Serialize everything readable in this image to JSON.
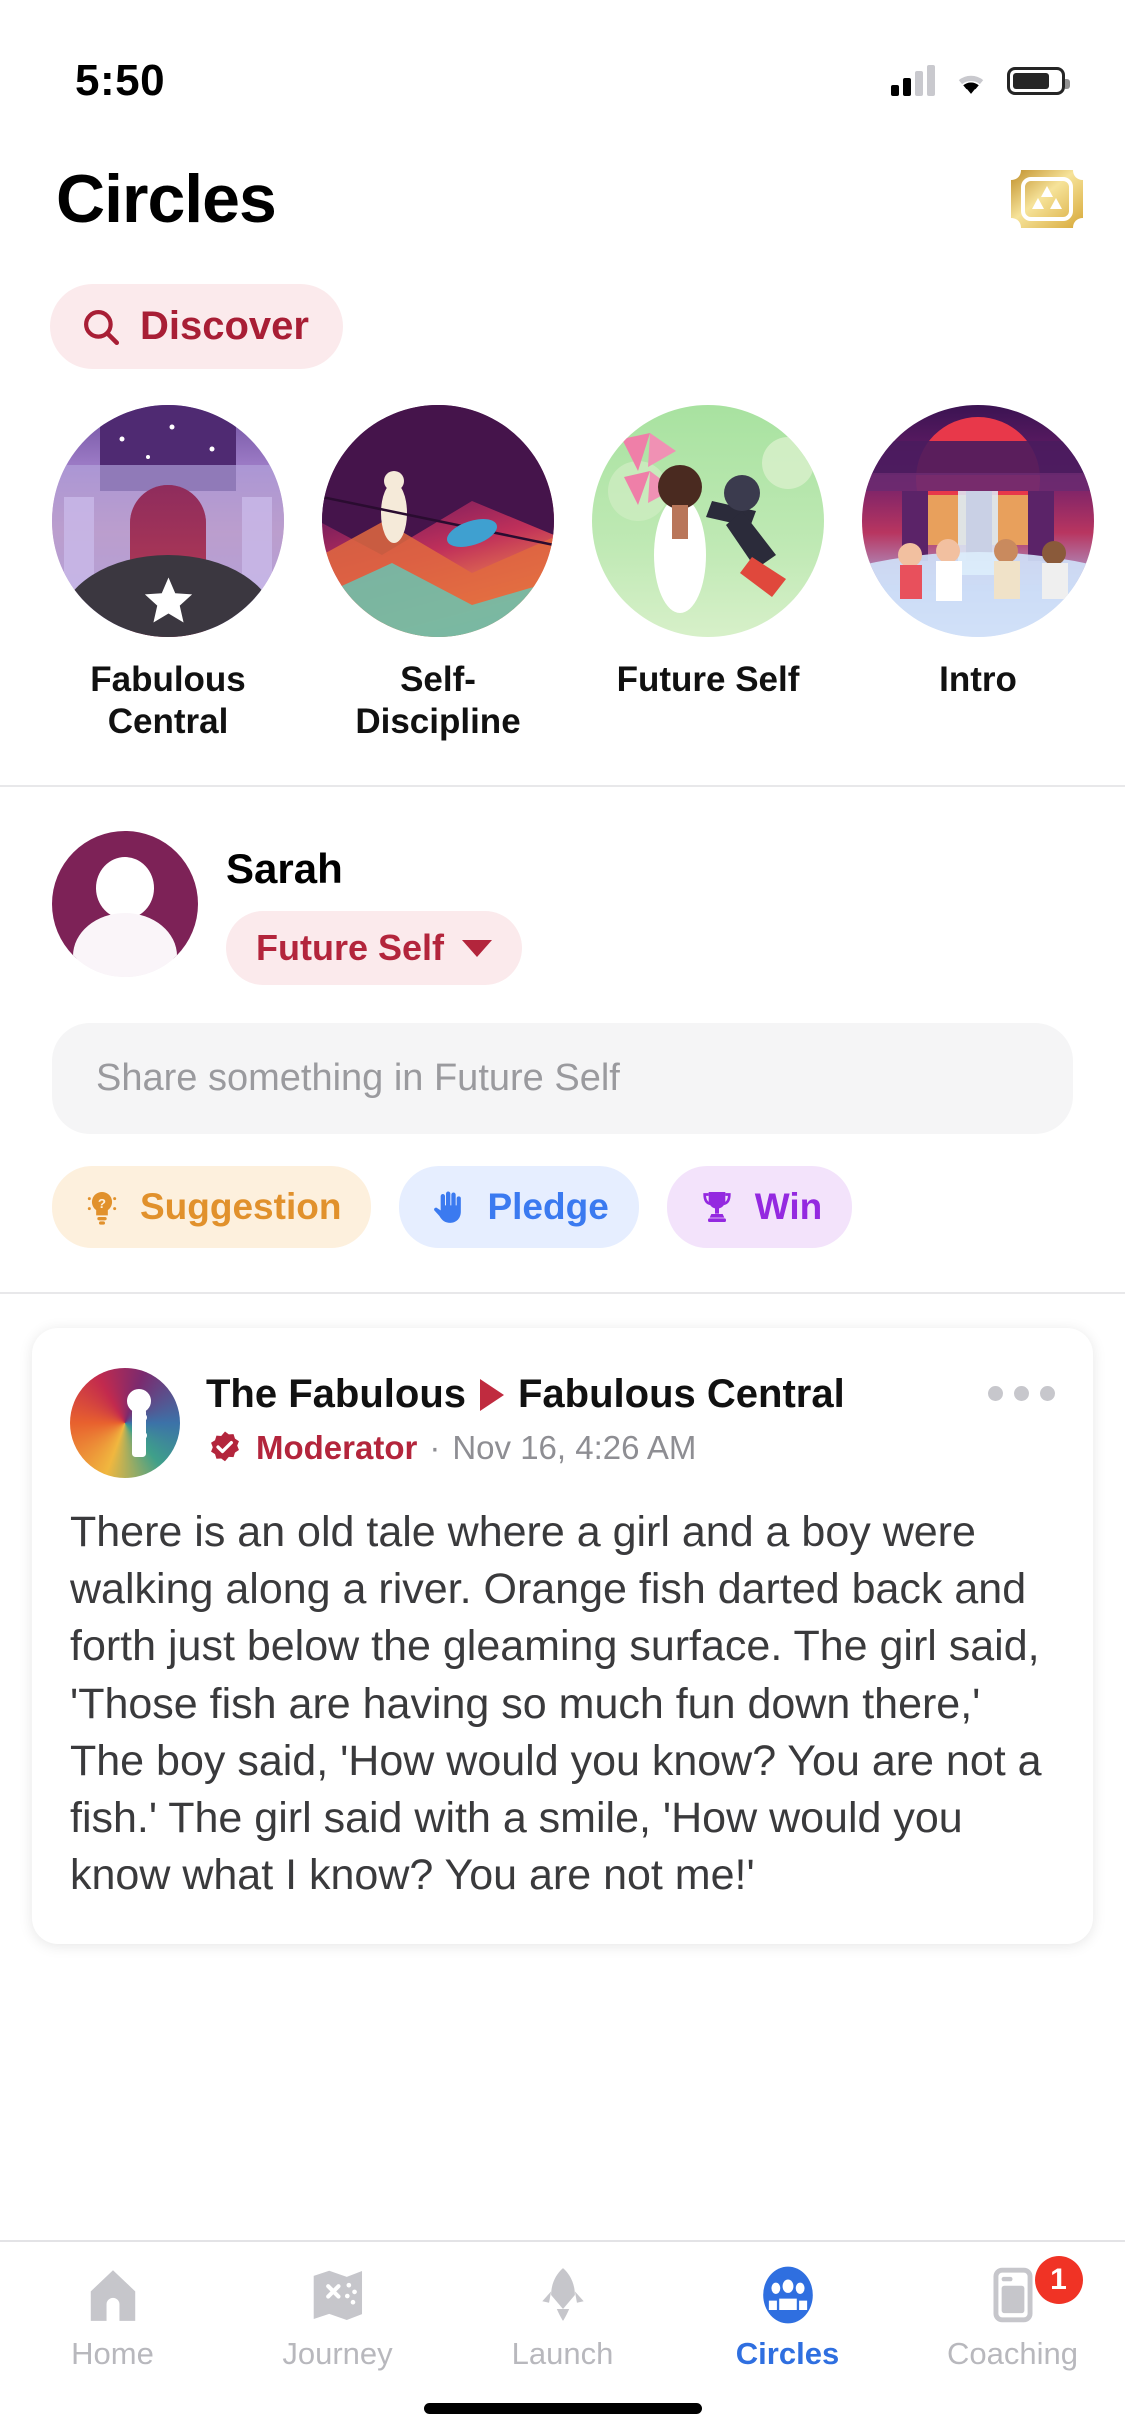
{
  "status_bar": {
    "time": "5:50",
    "cellular_icon": "cellular-signal-icon",
    "wifi_icon": "wifi-icon",
    "battery_icon": "battery-icon"
  },
  "header": {
    "title": "Circles",
    "badge_icon": "gold-achievement-badge-icon"
  },
  "discover": {
    "label": "Discover",
    "icon": "search-icon",
    "bg_color": "#fbeaec",
    "text_color": "#a81e35"
  },
  "circles": [
    {
      "label": "Fabulous Central",
      "art": "art1",
      "has_star": true
    },
    {
      "label": "Self-Discipline",
      "art": "art2",
      "has_star": false
    },
    {
      "label": "Future Self",
      "art": "art3",
      "has_star": false
    },
    {
      "label": "Intro",
      "art": "art4",
      "has_star": false
    }
  ],
  "composer": {
    "user_name": "Sarah",
    "selected_circle": "Future Self",
    "placeholder": "Share something in Future Self",
    "chips": [
      {
        "label": "Suggestion",
        "icon": "lightbulb-question-icon",
        "class": "chip-sug",
        "color": "#e1912c"
      },
      {
        "label": "Pledge",
        "icon": "raised-hand-icon",
        "class": "chip-pld",
        "color": "#3b7af0"
      },
      {
        "label": "Win",
        "icon": "trophy-icon",
        "class": "chip-win",
        "color": "#9429e0"
      }
    ]
  },
  "post": {
    "author": "The Fabulous",
    "circle": "Fabulous Central",
    "role": "Moderator",
    "separator": "·",
    "timestamp": "Nov 16, 4:26 AM",
    "body": "There is an old tale where a girl and a boy were walking along a river. Orange fish darted back and forth just below the gleaming surface. The girl said, 'Those fish are having so much fun down there,' The boy said, 'How would you know? You are not a fish.' The girl said with a smile, 'How would you know what I know? You are not me!'",
    "more_icon": "more-options-icon",
    "verified_icon": "verified-moderator-icon"
  },
  "tabs": [
    {
      "label": "Home",
      "icon": "home-icon",
      "active": false,
      "badge": null
    },
    {
      "label": "Journey",
      "icon": "map-icon",
      "active": false,
      "badge": null
    },
    {
      "label": "Launch",
      "icon": "rocket-icon",
      "active": false,
      "badge": null
    },
    {
      "label": "Circles",
      "icon": "people-icon",
      "active": true,
      "badge": null
    },
    {
      "label": "Coaching",
      "icon": "phone-icon",
      "active": false,
      "badge": "1"
    }
  ],
  "colors": {
    "accent_red": "#b3253c",
    "active_blue": "#2f6fe0",
    "badge_red": "#f03325"
  }
}
